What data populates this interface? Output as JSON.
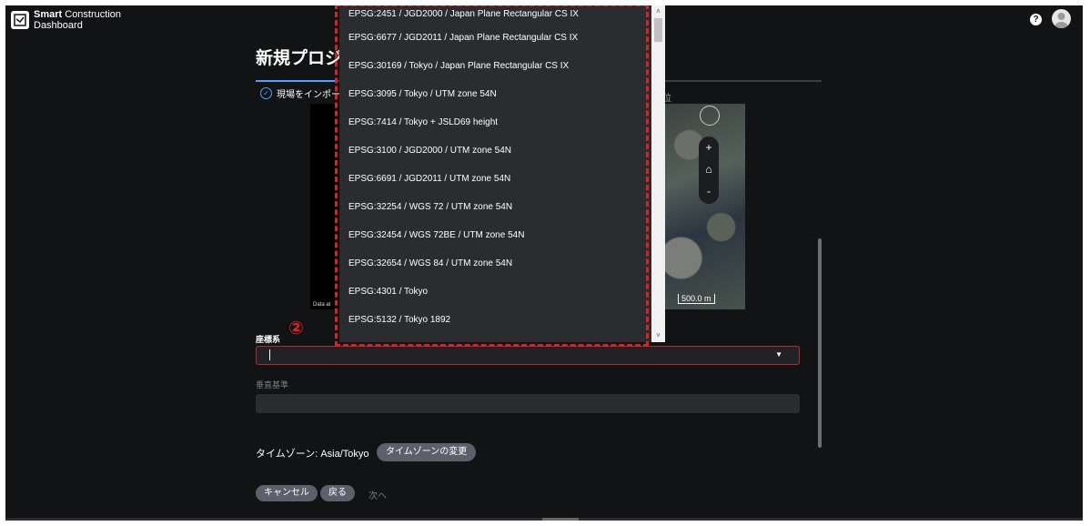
{
  "header": {
    "brand_line1_bold": "Smart",
    "brand_line1_rest": " Construction",
    "brand_line2": "Dashboard",
    "help_glyph": "?"
  },
  "page": {
    "title": "新規プロジ",
    "step1_label": "現場をインポー",
    "step3_label": "位"
  },
  "map": {
    "attribution": "Data at",
    "zoom_in": "+",
    "home": "⌂",
    "zoom_out": "-",
    "scale": "500.0 m"
  },
  "form": {
    "crs_label": "座標系",
    "crs_badge": "②",
    "vertical_label": "垂直基準",
    "timezone_label": "タイムゾーン: Asia/Tokyo",
    "timezone_button": "タイムゾーンの変更",
    "cancel_button": "キャンセル",
    "back_button": "戻る",
    "next_button": "次へ"
  },
  "dropdown": {
    "items": [
      "EPSG:2451 / JGD2000 / Japan Plane Rectangular CS IX",
      "EPSG:6677 / JGD2011 / Japan Plane Rectangular CS IX",
      "EPSG:30169 / Tokyo / Japan Plane Rectangular CS IX",
      "EPSG:3095 / Tokyo / UTM zone 54N",
      "EPSG:7414 / Tokyo + JSLD69 height",
      "EPSG:3100 / JGD2000 / UTM zone 54N",
      "EPSG:6691 / JGD2011 / UTM zone 54N",
      "EPSG:32254 / WGS 72 / UTM zone 54N",
      "EPSG:32454 / WGS 72BE / UTM zone 54N",
      "EPSG:32654 / WGS 84 / UTM zone 54N",
      "EPSG:4301 / Tokyo",
      "EPSG:5132 / Tokyo 1892"
    ],
    "scroll_up": "˄",
    "scroll_down": "˅"
  },
  "colors": {
    "background": "#111315",
    "accent": "#4aa3ff",
    "highlight": "#e02020"
  }
}
